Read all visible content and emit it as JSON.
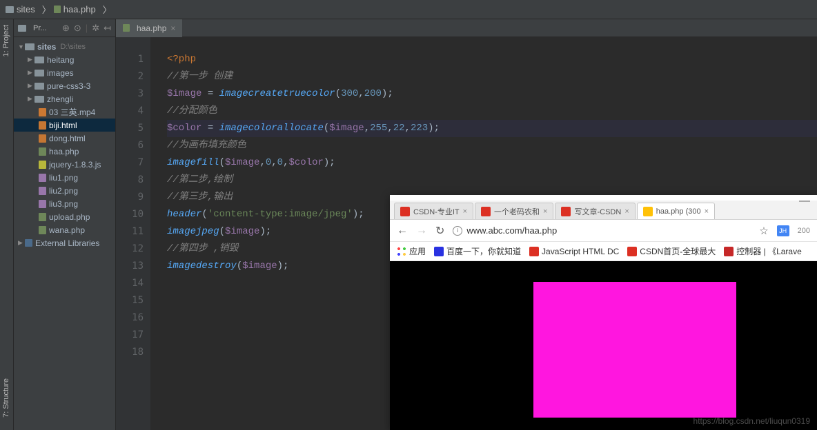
{
  "breadcrumb": {
    "root": "sites",
    "file": "haa.php"
  },
  "rail": {
    "project": "1: Project",
    "structure": "7: Structure"
  },
  "project_toolbar": {
    "label": "Pr..."
  },
  "tree": {
    "root": {
      "name": "sites",
      "path": "D:\\sites"
    },
    "folders": [
      "heitang",
      "images",
      "pure-css3-3",
      "zhengli"
    ],
    "files": [
      {
        "name": "03 三英.mp4",
        "type": "vid"
      },
      {
        "name": "biji.html",
        "type": "html",
        "selected": true
      },
      {
        "name": "dong.html",
        "type": "html"
      },
      {
        "name": "haa.php",
        "type": "php"
      },
      {
        "name": "jquery-1.8.3.js",
        "type": "js"
      },
      {
        "name": "liu1.png",
        "type": "img"
      },
      {
        "name": "liu2.png",
        "type": "img"
      },
      {
        "name": "liu3.png",
        "type": "img"
      },
      {
        "name": "upload.php",
        "type": "php"
      },
      {
        "name": "wana.php",
        "type": "php"
      }
    ],
    "libs": "External Libraries"
  },
  "editor_tab": {
    "title": "haa.php"
  },
  "line_count": 18,
  "code": {
    "l1_tag": "<?php",
    "l2_comment": "//第一步 创建",
    "l3": {
      "var": "$image",
      "func": "imagecreatetruecolor",
      "n1": "300",
      "n2": "200"
    },
    "l4_comment": "//分配颜色",
    "l5": {
      "var": "$color",
      "func": "imagecolorallocate",
      "arg": "$image",
      "n1": "255",
      "n2": "22",
      "n3": "223"
    },
    "l6_comment": "//为画布填充颜色",
    "l7": {
      "func": "imagefill",
      "arg": "$image",
      "n1": "0",
      "n2": "0",
      "v2": "$color"
    },
    "l8_comment": "//第二步,绘制",
    "l9_comment": "//第三步,输出",
    "l10": {
      "func": "header",
      "str": "'content-type:image/jpeg'"
    },
    "l11": {
      "func": "imagejpeg",
      "arg": "$image"
    },
    "l12_comment": "//第四步 ,销毁",
    "l13": {
      "func": "imagedestroy",
      "arg": "$image"
    }
  },
  "browser": {
    "tabs": [
      {
        "title": "CSDN-专业IT",
        "ico": "csdn"
      },
      {
        "title": "一个老码农和",
        "ico": "csdn"
      },
      {
        "title": "写文章-CSDN",
        "ico": "csdn"
      },
      {
        "title": "haa.php (300",
        "ico": "haa",
        "active": true
      }
    ],
    "url": "www.abc.com/haa.php",
    "badge": "JH",
    "count": "200",
    "bookmarks": {
      "apps": "应用",
      "baidu": "百度一下，你就知道",
      "js": "JavaScript HTML DC",
      "csdn": "CSDN首页-全球最大",
      "ctrl": "控制器 | 《Larave"
    },
    "watermark": "https://blog.csdn.net/liuqun0319"
  }
}
